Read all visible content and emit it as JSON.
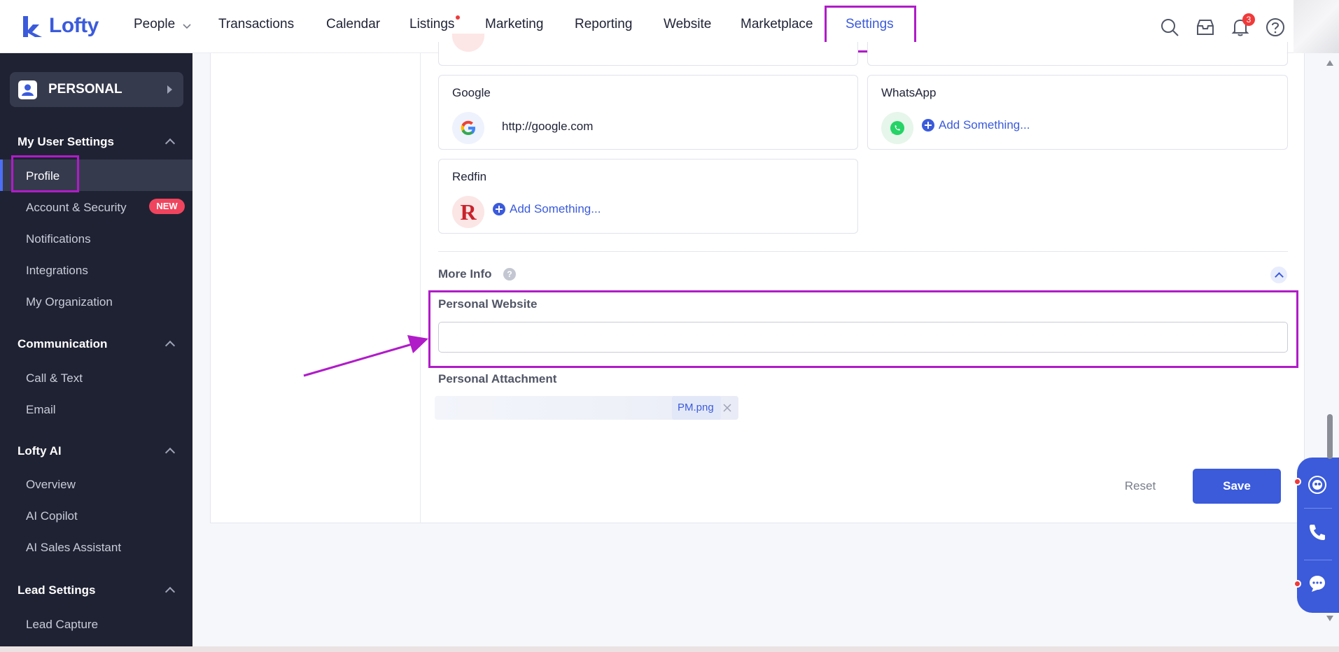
{
  "brand": {
    "name": "Lofty"
  },
  "nav": {
    "items": [
      {
        "label": "People"
      },
      {
        "label": "Transactions"
      },
      {
        "label": "Calendar"
      },
      {
        "label": "Listings"
      },
      {
        "label": "Marketing"
      },
      {
        "label": "Reporting"
      },
      {
        "label": "Website"
      },
      {
        "label": "Marketplace"
      },
      {
        "label": "Settings"
      }
    ],
    "notification_count": "3"
  },
  "sidebar": {
    "workspace_label": "PERSONAL",
    "sections": [
      {
        "title": "My User Settings",
        "items": [
          "Profile",
          "Account & Security",
          "Notifications",
          "Integrations",
          "My Organization"
        ]
      },
      {
        "title": "Communication",
        "items": [
          "Call & Text",
          "Email"
        ]
      },
      {
        "title": "Lofty AI",
        "items": [
          "Overview",
          "AI Copilot",
          "AI Sales Assistant"
        ]
      },
      {
        "title": "Lead Settings",
        "items": [
          "Lead Capture"
        ]
      }
    ],
    "new_badge": "NEW"
  },
  "social": {
    "google": {
      "title": "Google",
      "value": "http://google.com"
    },
    "whatsapp": {
      "title": "WhatsApp",
      "add_label": "Add Something..."
    },
    "redfin": {
      "title": "Redfin",
      "add_label": "Add Something...",
      "icon_letter": "R"
    }
  },
  "more_info": {
    "title": "More Info",
    "help": "?",
    "personal_website_label": "Personal Website",
    "personal_website_value": "",
    "personal_attachment_label": "Personal Attachment",
    "attachment_name": "PM.png"
  },
  "actions": {
    "reset": "Reset",
    "save": "Save"
  },
  "colors": {
    "accent": "#3b5bdb",
    "highlight": "#b01cc8",
    "sidebar_bg": "#1f2233",
    "danger": "#f03a3a"
  }
}
